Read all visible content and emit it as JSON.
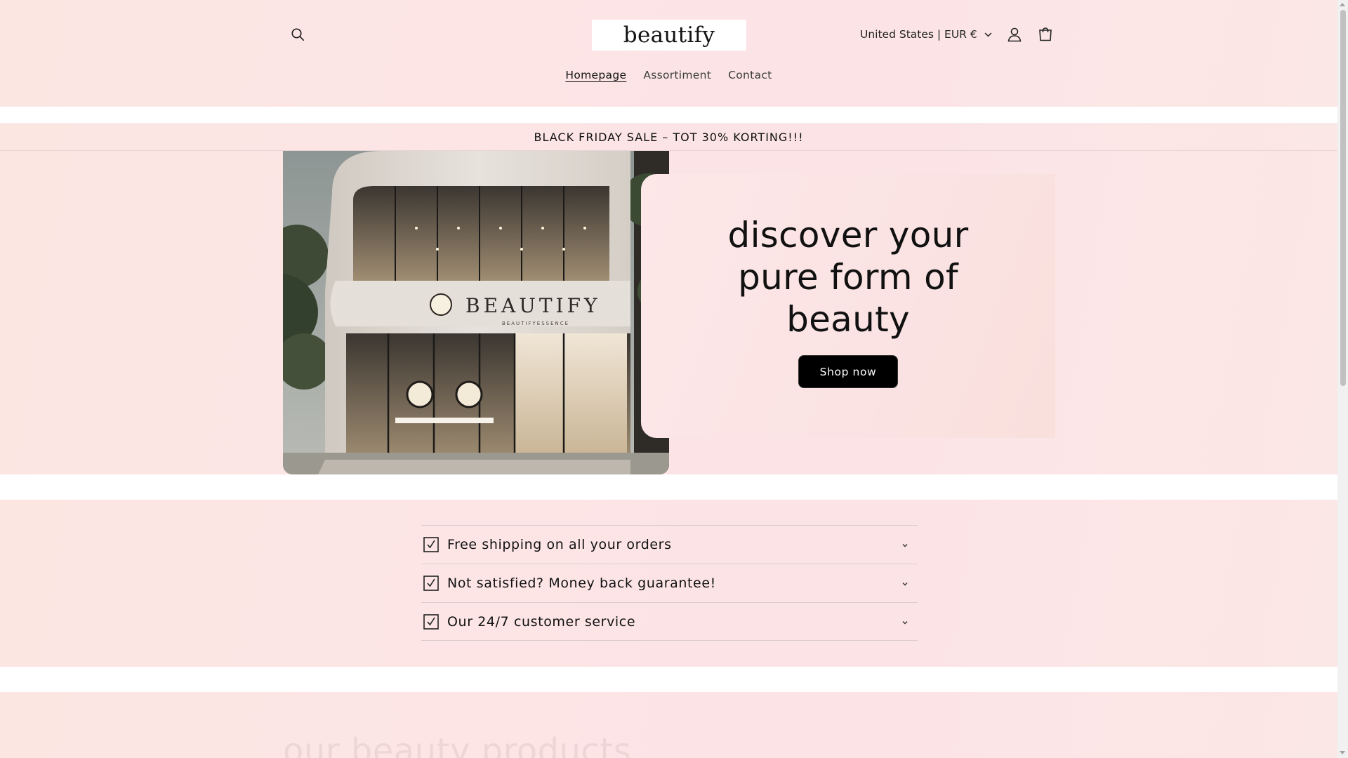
{
  "header": {
    "logo": "beautify",
    "currency_label": "United States | EUR €",
    "icons": {
      "search": "search-icon",
      "account": "account-icon",
      "cart": "cart-icon",
      "chevron": "chevron-down-icon"
    }
  },
  "nav": {
    "items": [
      {
        "label": "Homepage",
        "active": true
      },
      {
        "label": "Assortiment",
        "active": false
      },
      {
        "label": "Contact",
        "active": false
      }
    ]
  },
  "announcement": {
    "text": "BLACK FRIDAY SALE – TOT 30% KORTING!!!"
  },
  "hero": {
    "image_sign_text": "BEAUTIFY",
    "image_sign_subtext": "BEAUTIFYESSENCE",
    "title": "discover your pure form of beauty",
    "button_label": "Shop now"
  },
  "features": {
    "items": [
      {
        "label": "Free shipping on all your orders",
        "icon": "checkbox-icon"
      },
      {
        "label": "Not satisfied? Money back guarantee!",
        "icon": "checkbox-icon"
      },
      {
        "label": "Our 24/7 customer service",
        "icon": "checkbox-icon"
      }
    ]
  },
  "products_section": {
    "title": "our beauty products"
  },
  "colors": {
    "accent_bg": "#fce4e6",
    "button_bg": "#000000",
    "text": "#121212"
  }
}
